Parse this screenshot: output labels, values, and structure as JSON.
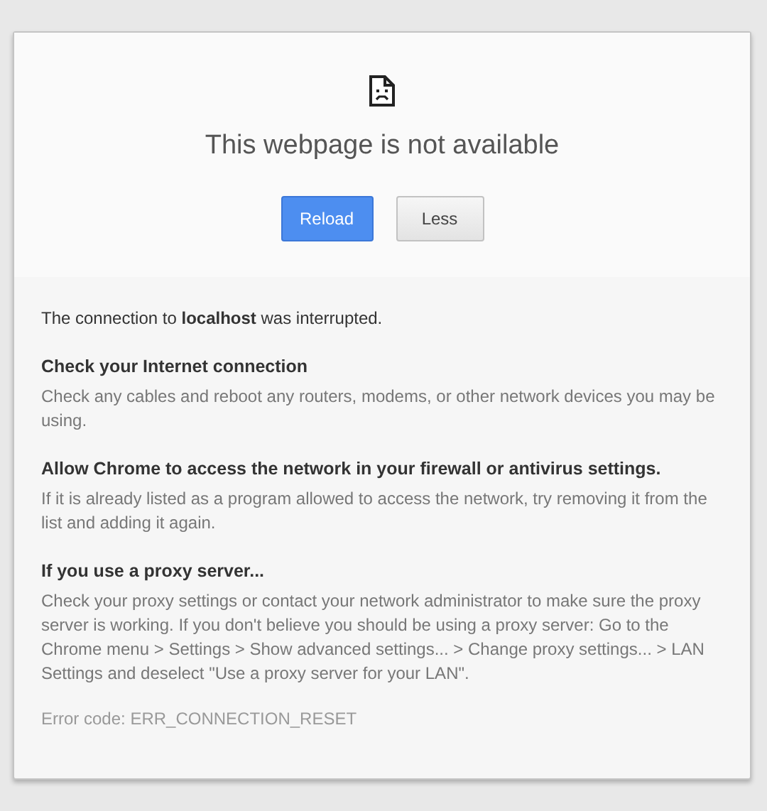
{
  "title": "This webpage is not available",
  "buttons": [
    {
      "label": "Reload",
      "kind": "primary"
    },
    {
      "label": "Less",
      "kind": "secondary"
    }
  ],
  "summary": "The connection to **localhost** was interrupted.",
  "suggestions": [
    {
      "heading": "Check your Internet connection",
      "body": "Check any cables and reboot any routers, modems, or other network devices you may be using."
    },
    {
      "heading": "Allow Chrome to access the network in your firewall or antivirus settings.",
      "body": "If it is already listed as a program allowed to access the network, try removing it from the list and adding it again."
    },
    {
      "heading": "If you use a proxy server...",
      "body": "Check your proxy settings or contact your network administrator to make sure the proxy server is working. If you don't believe you should be using a proxy server: Go to the Chrome menu > Settings > Show advanced settings... > Change proxy settings... > LAN Settings and deselect \"Use a proxy server for your LAN\"."
    }
  ],
  "error_code": "Error code: ERR_CONNECTION_RESET"
}
